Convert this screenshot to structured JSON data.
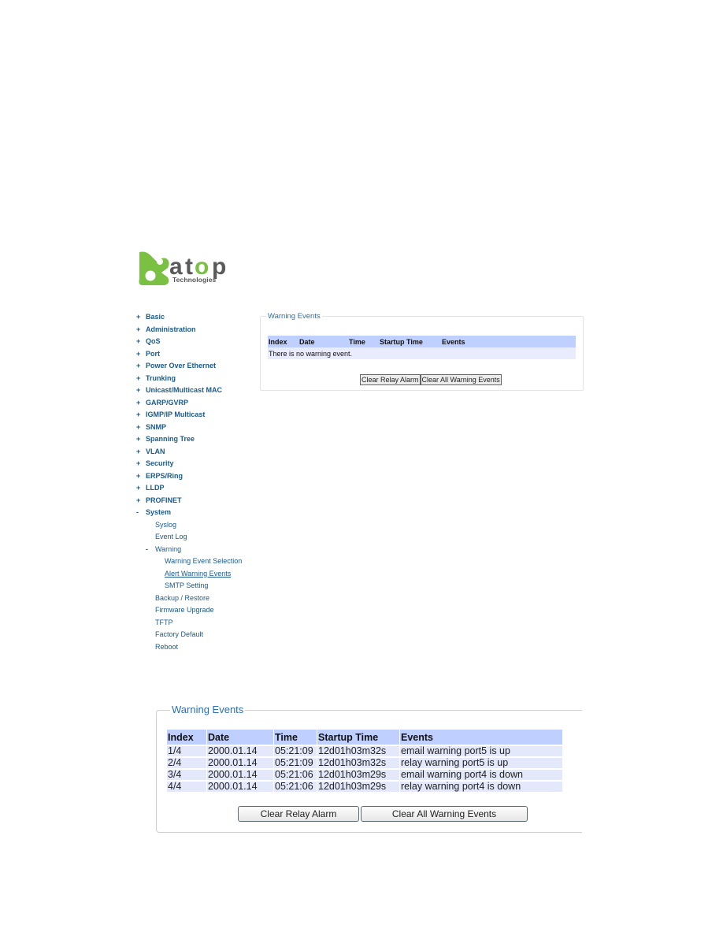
{
  "brand": {
    "logo_text": "atop",
    "logo_subtext": "Technologies",
    "colors": {
      "green": "#7ac143",
      "gray": "#5a5a5a",
      "link": "#1a5a8c",
      "header_row": "#bfcfff",
      "data_row": "#e3e8fb",
      "legend": "#2a6fb3"
    }
  },
  "nav": {
    "items": [
      {
        "label": "Basic",
        "bullet": "+"
      },
      {
        "label": "Administration",
        "bullet": "+"
      },
      {
        "label": "QoS",
        "bullet": "+"
      },
      {
        "label": "Port",
        "bullet": "+"
      },
      {
        "label": "Power Over Ethernet",
        "bullet": "+"
      },
      {
        "label": "Trunking",
        "bullet": "+"
      },
      {
        "label": "Unicast/Multicast MAC",
        "bullet": "+"
      },
      {
        "label": "GARP/GVRP",
        "bullet": "+"
      },
      {
        "label": "IGMP/IP Multicast",
        "bullet": "+"
      },
      {
        "label": "SNMP",
        "bullet": "+"
      },
      {
        "label": "Spanning Tree",
        "bullet": "+"
      },
      {
        "label": "VLAN",
        "bullet": "+"
      },
      {
        "label": "Security",
        "bullet": "+"
      },
      {
        "label": "ERPS/Ring",
        "bullet": "+"
      },
      {
        "label": "LLDP",
        "bullet": "+"
      },
      {
        "label": "PROFINET",
        "bullet": "+"
      },
      {
        "label": "System",
        "bullet": "-"
      }
    ],
    "system_children": {
      "syslog": "Syslog",
      "event_log": "Event Log",
      "warning": {
        "label": "Warning",
        "bullet": "-"
      },
      "warning_children": [
        "Warning Event Selection",
        "Alert Warning Events",
        "SMTP Setting"
      ],
      "after": [
        "Backup / Restore",
        "Firmware Upgrade",
        "TFTP",
        "Factory Default",
        "Reboot"
      ]
    }
  },
  "panel_small": {
    "legend": "Warning Events",
    "headers": [
      "Index",
      "Date",
      "Time",
      "Startup Time",
      "Events"
    ],
    "empty_message": "There is no warning event.",
    "buttons": {
      "clear_relay": "Clear Relay Alarm",
      "clear_all": "Clear All Warning Events"
    }
  },
  "panel_big": {
    "legend": "Warning Events",
    "headers": [
      "Index",
      "Date",
      "Time",
      "Startup Time",
      "Events"
    ],
    "rows": [
      [
        "1/4",
        "2000.01.14",
        "05:21:09",
        "12d01h03m32s",
        "email warning port5 is up"
      ],
      [
        "2/4",
        "2000.01.14",
        "05:21:09",
        "12d01h03m32s",
        "relay warning port5 is up"
      ],
      [
        "3/4",
        "2000.01.14",
        "05:21:06",
        "12d01h03m29s",
        "email warning port4 is down"
      ],
      [
        "4/4",
        "2000.01.14",
        "05:21:06",
        "12d01h03m29s",
        "relay warning port4 is down"
      ]
    ],
    "buttons": {
      "clear_relay": "Clear Relay Alarm",
      "clear_all": "Clear All Warning Events"
    }
  }
}
